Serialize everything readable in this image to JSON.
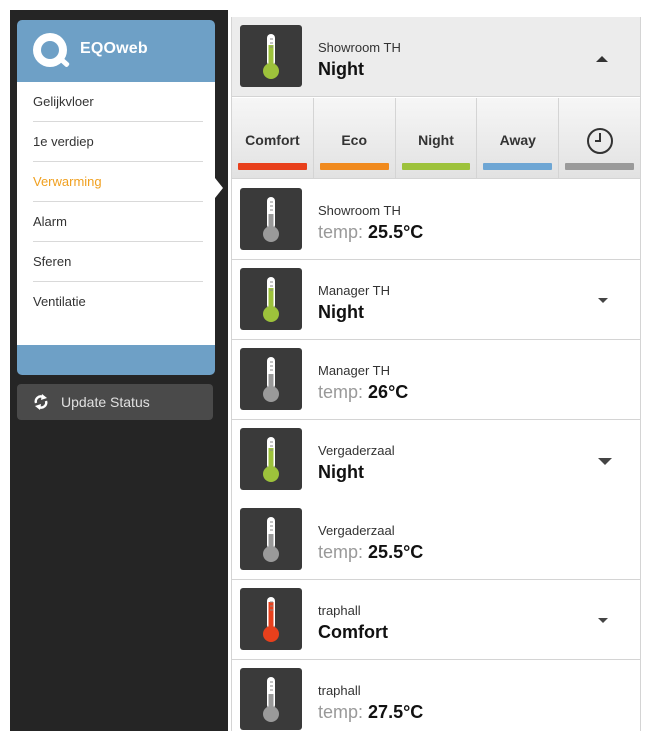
{
  "app": {
    "logo_text": "EQOweb"
  },
  "nav": {
    "items": [
      {
        "label": "Gelijkvloer"
      },
      {
        "label": "1e verdiep"
      },
      {
        "label": "Verwarming",
        "active": true
      },
      {
        "label": "Alarm"
      },
      {
        "label": "Sferen"
      },
      {
        "label": "Ventilatie"
      }
    ],
    "update_label": "Update Status"
  },
  "colors": {
    "accent_blue": "#6ea0c6",
    "active_nav": "#f0a020",
    "comfort": "#e8401c",
    "eco": "#f08a1e",
    "night": "#9dc23b",
    "away": "#6ea6d4",
    "clock": "#9a9a9a",
    "thermo_gray": "#9a9a9a"
  },
  "modes": [
    {
      "label": "Comfort",
      "color": "#e8401c"
    },
    {
      "label": "Eco",
      "color": "#f08a1e"
    },
    {
      "label": "Night",
      "color": "#9dc23b"
    },
    {
      "label": "Away",
      "color": "#6ea6d4"
    },
    {
      "label": "",
      "icon": "clock-icon",
      "color": "#9a9a9a"
    }
  ],
  "rows": [
    {
      "title": "Showroom TH",
      "value": "Night",
      "kind": "mode",
      "thermo": "#9dc23b",
      "expanded": true
    },
    {
      "title": "Showroom TH",
      "temp_prefix": "temp:",
      "temp": "25.5°C",
      "kind": "temp",
      "thermo": "#9a9a9a"
    },
    {
      "title": "Manager TH",
      "value": "Night",
      "kind": "mode",
      "thermo": "#9dc23b"
    },
    {
      "title": "Manager TH",
      "temp_prefix": "temp:",
      "temp": "26°C",
      "kind": "temp",
      "thermo": "#9a9a9a"
    },
    {
      "title": "Vergaderzaal",
      "value": "Night",
      "kind": "mode",
      "thermo": "#9dc23b"
    },
    {
      "title": "Vergaderzaal",
      "temp_prefix": "temp:",
      "temp": "25.5°C",
      "kind": "temp",
      "thermo": "#9a9a9a"
    },
    {
      "title": "traphall",
      "value": "Comfort",
      "kind": "mode",
      "thermo": "#e8401c"
    },
    {
      "title": "traphall",
      "temp_prefix": "temp:",
      "temp": "27.5°C",
      "kind": "temp",
      "thermo": "#9a9a9a"
    }
  ]
}
